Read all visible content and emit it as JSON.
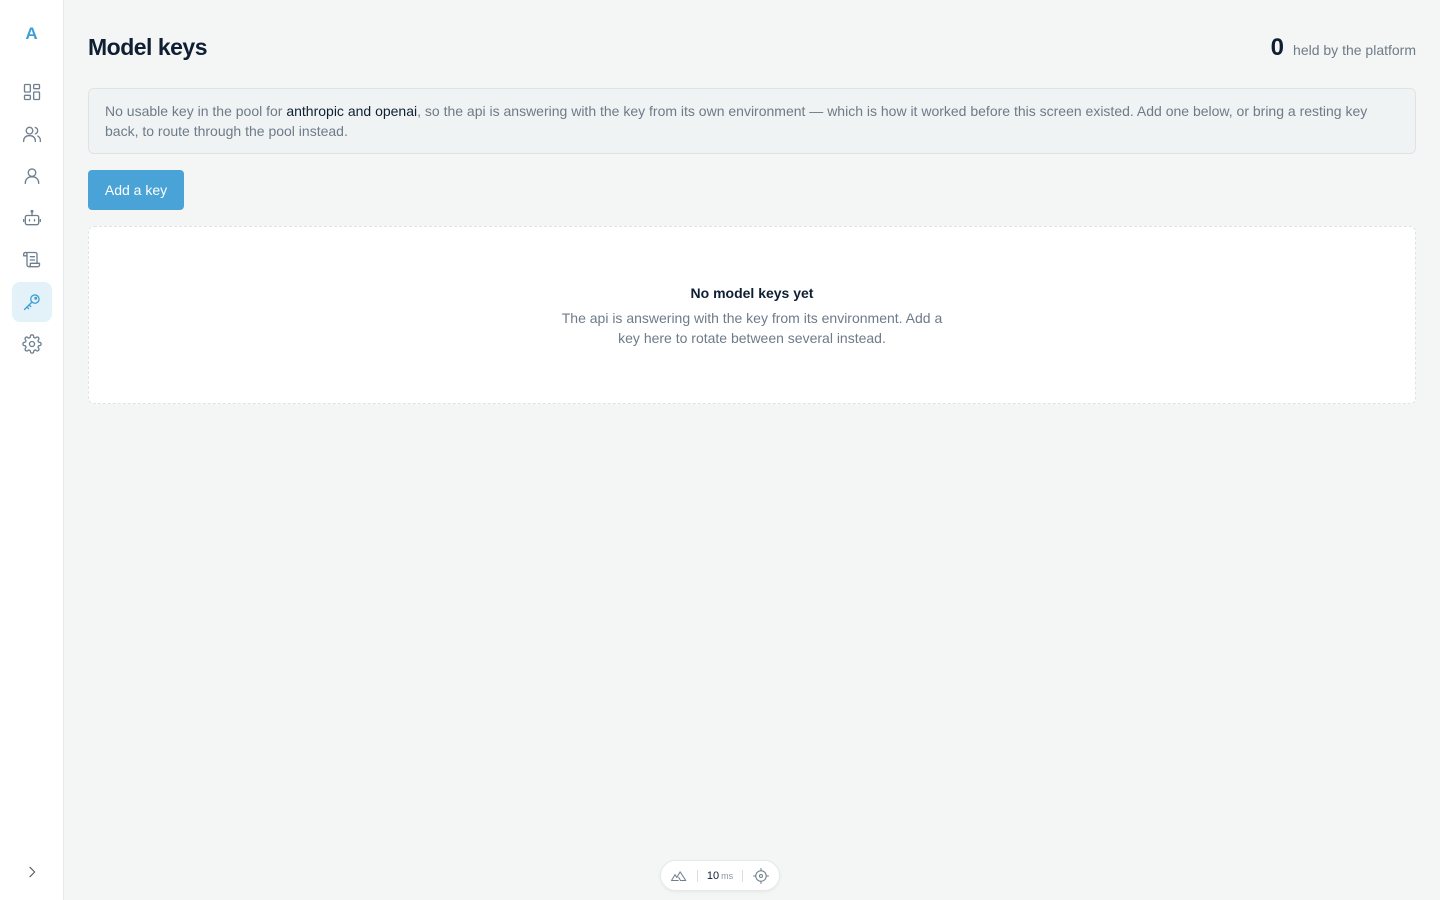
{
  "app": {
    "logo_letter": "A"
  },
  "sidebar": {
    "items": [
      {
        "name": "dashboard",
        "icon": "grid-icon",
        "active": false
      },
      {
        "name": "teams",
        "icon": "users-icon",
        "active": false
      },
      {
        "name": "users",
        "icon": "user-icon",
        "active": false
      },
      {
        "name": "agents",
        "icon": "robot-icon",
        "active": false
      },
      {
        "name": "logs",
        "icon": "scroll-icon",
        "active": false
      },
      {
        "name": "model-keys",
        "icon": "key-icon",
        "active": true
      },
      {
        "name": "settings",
        "icon": "gear-icon",
        "active": false
      }
    ],
    "collapse_icon": "chevron-right-icon"
  },
  "header": {
    "title": "Model keys",
    "stat_value": "0",
    "stat_label": "held by the platform"
  },
  "notice": {
    "before": "No usable key in the pool for ",
    "providers": "anthropic and openai",
    "after": ", so the api is answering with the key from its own environment — which is how it worked before this screen existed. Add one below, or bring a resting key back, to route through the pool instead."
  },
  "actions": {
    "add_label": "Add a key"
  },
  "empty_state": {
    "title": "No model keys yet",
    "description": "The api is answering with the key from its environment. Add a key here to rotate between several instead."
  },
  "devbar": {
    "latency_value": "10",
    "latency_unit": "ms"
  },
  "colors": {
    "accent": "#4aa3d6",
    "background": "#f4f6f5",
    "text": "#0f1f33",
    "muted": "#6e7b88"
  }
}
